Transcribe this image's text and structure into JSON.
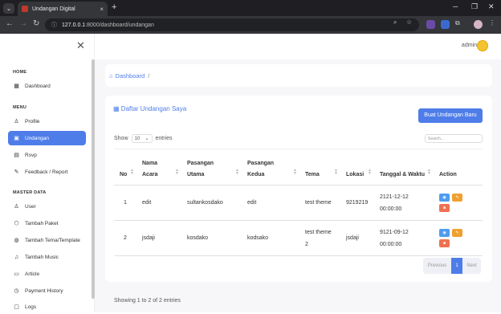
{
  "browser": {
    "tab_title": "Undangan Digital",
    "url_host": "127.0.0.1",
    "url_path": ":8000/dashboard/undangan",
    "new_tab": "+",
    "tab_close": "×"
  },
  "sidebar": {
    "sections": [
      {
        "title": "HOME",
        "items": [
          {
            "label": "Dashboard",
            "icon": "grid-icon"
          }
        ]
      },
      {
        "title": "MENU",
        "items": [
          {
            "label": "Profile",
            "icon": "user-icon"
          },
          {
            "label": "Undangan",
            "icon": "gift-icon",
            "active": true
          },
          {
            "label": "Rsvp",
            "icon": "calendar-icon"
          },
          {
            "label": "Feedback / Report",
            "icon": "pencil-icon"
          }
        ]
      },
      {
        "title": "MASTER DATA",
        "items": [
          {
            "label": "User",
            "icon": "user-icon"
          },
          {
            "label": "Tambah Paket",
            "icon": "package-icon"
          },
          {
            "label": "Tambah Tema/Template",
            "icon": "palette-icon"
          },
          {
            "label": "Tambah Music",
            "icon": "music-icon"
          },
          {
            "label": "Article",
            "icon": "article-icon"
          },
          {
            "label": "Payment History",
            "icon": "history-icon"
          },
          {
            "label": "Logs",
            "icon": "logs-icon"
          }
        ]
      }
    ]
  },
  "topbar": {
    "username": "admin"
  },
  "breadcrumb": {
    "home": "Dashboard",
    "separator": "/"
  },
  "card": {
    "title": "Daftar Undangan Saya",
    "new_button": "Buat Undangan Baru",
    "show_label": "Show",
    "entries_value": "10",
    "entries_label": "entries",
    "search_placeholder": "Search..."
  },
  "table": {
    "headers": [
      "No",
      "Nama\nAcara",
      "Pasangan\nUtama",
      "Pasangan\nKedua",
      "Tema",
      "Lokasi",
      "Tanggal & Waktu",
      "Action"
    ],
    "rows": [
      {
        "no": "1",
        "nama": "edit",
        "utama": "sultankosdako",
        "kedua": "edit",
        "tema": "test theme",
        "lokasi": "9219219",
        "tanggal": "2121-12-12\n00:00:00"
      },
      {
        "no": "2",
        "nama": "jsdaji",
        "utama": "kosdako",
        "kedua": "kodsako",
        "tema": "test theme\n2",
        "lokasi": "jsdaji",
        "tanggal": "9121-09-12\n00:00:00"
      }
    ]
  },
  "footer": {
    "showing": "Showing 1 to 2 of 2 entries",
    "previous": "Previous",
    "page": "1",
    "next": "Next"
  },
  "colors": {
    "accent": "#4e7de9",
    "view": "#4e9cf0",
    "edit": "#f0a030",
    "delete": "#f07050"
  }
}
